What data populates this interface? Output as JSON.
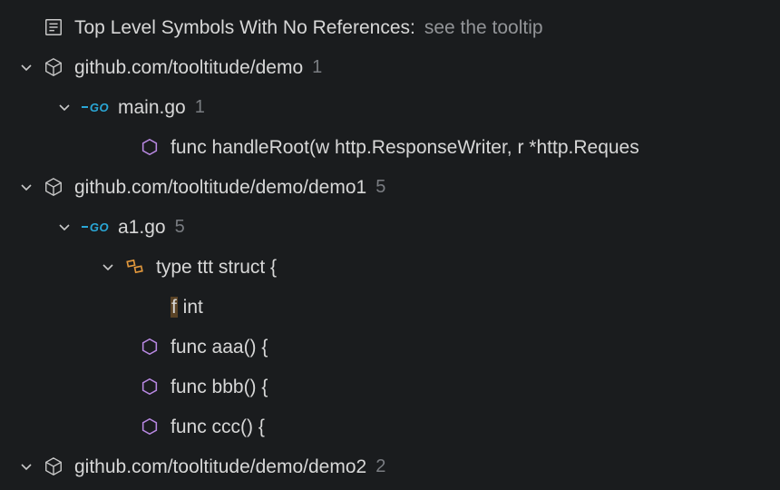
{
  "header": {
    "title": "Top Level Symbols With No References:",
    "hint": "see the tooltip"
  },
  "packages": [
    {
      "name": "github.com/tooltitude/demo",
      "count": "1",
      "files": [
        {
          "name": "main.go",
          "count": "1",
          "symbols": [
            {
              "kind": "func",
              "label": "func handleRoot(w http.ResponseWriter, r *http.Reques"
            }
          ]
        }
      ]
    },
    {
      "name": "github.com/tooltitude/demo/demo1",
      "count": "5",
      "files": [
        {
          "name": "a1.go",
          "count": "5",
          "symbols": [
            {
              "kind": "struct",
              "label": "type ttt struct {",
              "children": [
                {
                  "highlight": "f",
                  "rest": " int"
                }
              ]
            },
            {
              "kind": "func",
              "label": "func aaa() {"
            },
            {
              "kind": "func",
              "label": "func bbb() {"
            },
            {
              "kind": "func",
              "label": "func ccc() {"
            }
          ]
        }
      ]
    },
    {
      "name": "github.com/tooltitude/demo/demo2",
      "count": "2"
    }
  ],
  "colors": {
    "bg": "#1a1c1e",
    "text": "#d7d7d7",
    "muted": "#7a7d82",
    "hint": "#929497",
    "go": "#2aa7d6",
    "purple": "#b888e2",
    "orange": "#e2983c",
    "highlightBg": "#5a4326"
  }
}
